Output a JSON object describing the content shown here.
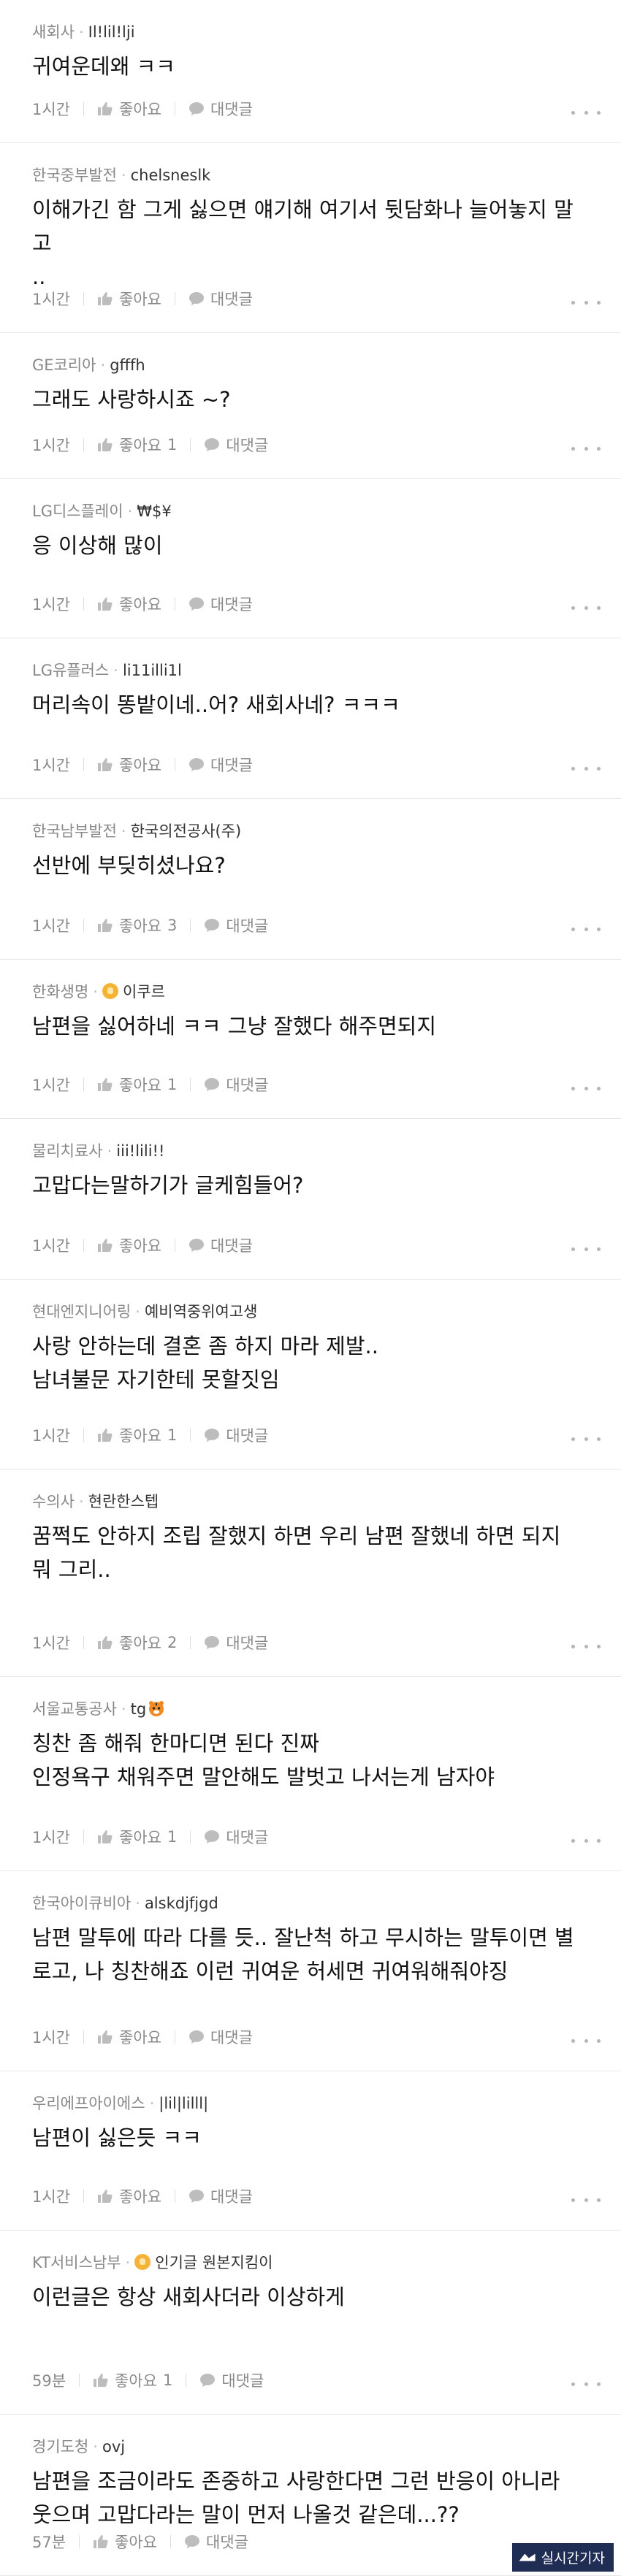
{
  "labels": {
    "like": "좋아요",
    "reply": "대댓글"
  },
  "watermark": "실시간기자",
  "comments": [
    {
      "company": "새회사",
      "author": "Il!lil!lji",
      "text": [
        "귀여운데왜 ㅋㅋ"
      ],
      "time": "1시간",
      "likes": ""
    },
    {
      "company": "한국중부발전",
      "author": "chelsneslk",
      "text": [
        "이해가긴 함 그게 싫으면 얘기해 여기서 뒷담화나 늘어놓지 말고",
        ".."
      ],
      "time": "1시간",
      "likes": ""
    },
    {
      "company": "GE코리아",
      "author": "gfffh",
      "text": [
        "그래도 사랑하시죠 ~?"
      ],
      "time": "1시간",
      "likes": "1"
    },
    {
      "company": "LG디스플레이",
      "author": "₩$¥",
      "text": [
        "응 이상해 많이"
      ],
      "time": "1시간",
      "likes": ""
    },
    {
      "company": "LG유플러스",
      "author": "li11illi1l",
      "text": [
        "머리속이 똥밭이네..어? 새회사네? ㅋㅋㅋ"
      ],
      "time": "1시간",
      "likes": ""
    },
    {
      "company": "한국남부발전",
      "author": "한국의전공사(주)",
      "text": [
        "선반에 부딪히셨나요?"
      ],
      "time": "1시간",
      "likes": "3"
    },
    {
      "company": "한화생명",
      "author": "이쿠르",
      "badge": true,
      "text": [
        "남편을 싫어하네 ㅋㅋ 그냥 잘했다 해주면되지"
      ],
      "time": "1시간",
      "likes": "1"
    },
    {
      "company": "물리치료사",
      "author": "iii!lili!!",
      "text": [
        "고맙다는말하기가 글케힘들어?"
      ],
      "time": "1시간",
      "likes": ""
    },
    {
      "company": "현대엔지니어링",
      "author": "예비역중위여고생",
      "text": [
        "사랑 안하는데 결혼 좀 하지 마라 제발..",
        "남녀불문 자기한테 못할짓임"
      ],
      "time": "1시간",
      "likes": "1"
    },
    {
      "company": "수의사",
      "author": "현란한스텝",
      "text": [
        "꿈쩍도 안하지 조립 잘했지 하면 우리 남편 잘했네 하면 되지",
        "뭐 그리.."
      ],
      "time": "1시간",
      "likes": "2"
    },
    {
      "company": "서울교통공사",
      "author": "tg",
      "tiger": true,
      "text": [
        "칭찬 좀 해줘 한마디면 된다 진짜",
        "인정욕구 채워주면 말안해도 발벗고 나서는게 남자야"
      ],
      "time": "1시간",
      "likes": "1"
    },
    {
      "company": "한국아이큐비아",
      "author": "alskdjfjgd",
      "text": [
        "남편 말투에 따라 다를 듯.. 잘난척 하고 무시하는 말투이면 별",
        "로고, 나 칭찬해죠 이런 귀여운 허세면 귀여워해줘야징"
      ],
      "time": "1시간",
      "likes": ""
    },
    {
      "company": "우리에프아이에스",
      "author": "|lil|lilll|",
      "text": [
        "남편이 싫은듯 ㅋㅋ"
      ],
      "time": "1시간",
      "likes": ""
    },
    {
      "company": "KT서비스남부",
      "author": "인기글 원본지킴이",
      "badge": true,
      "text": [
        "이런글은 항상 새회사더라 이상하게"
      ],
      "time": "59분",
      "likes": "1"
    },
    {
      "company": "경기도청",
      "author": "ovj",
      "text": [
        "남편을 조금이라도 존중하고 사랑한다면 그런 반응이 아니라",
        "웃으며 고맙다라는 말이 먼저 나올것  같은데...??"
      ],
      "time": "57분",
      "likes": ""
    }
  ],
  "colors": {
    "badge": "#f5b335",
    "watermark_bg": "#1f2c54"
  }
}
